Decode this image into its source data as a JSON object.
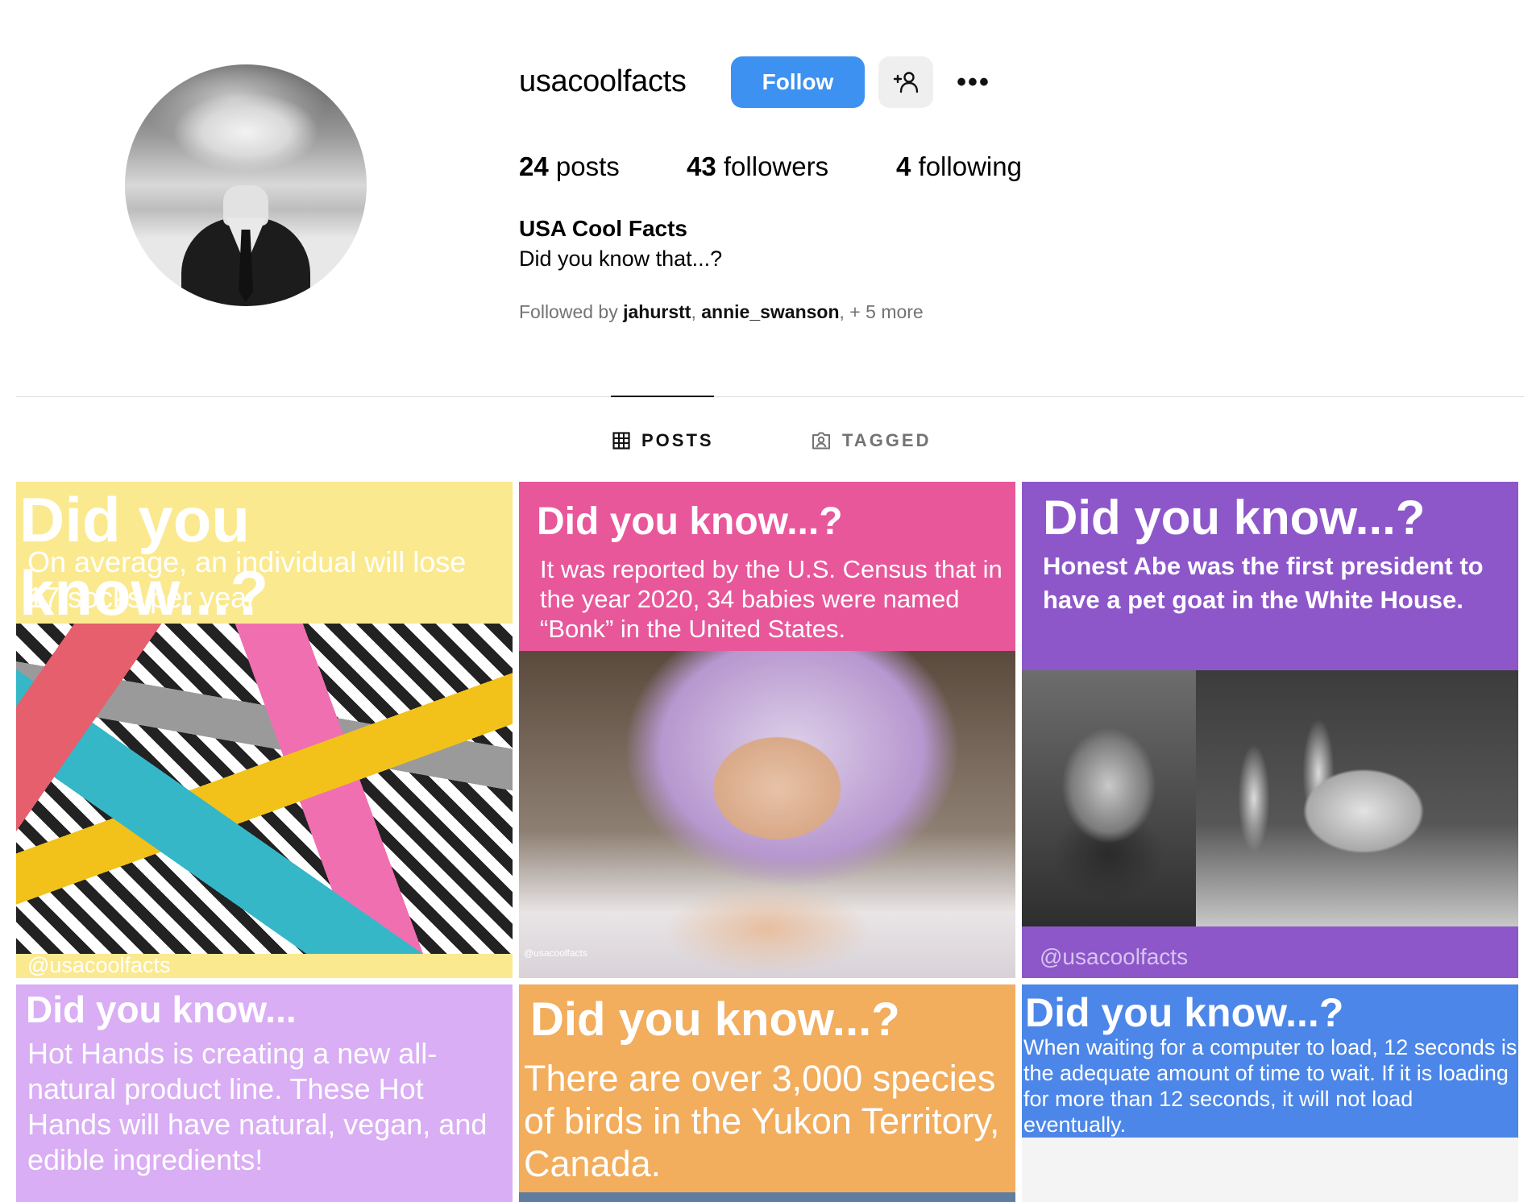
{
  "profile": {
    "username": "usacoolfacts",
    "follow_label": "Follow",
    "more_label": "•••",
    "stats": {
      "posts_count": "24",
      "posts_label": " posts",
      "followers_count": "43",
      "followers_label": " followers",
      "following_count": "4",
      "following_label": " following"
    },
    "full_name": "USA Cool Facts",
    "bio": "Did you know that...?",
    "followed_by": {
      "prefix": "Followed by ",
      "user1": "jahurstt",
      "sep": ", ",
      "user2": "annie_swanson",
      "suffix": ", + 5 more"
    }
  },
  "tabs": [
    {
      "label": "POSTS",
      "icon": "grid-icon",
      "active": true
    },
    {
      "label": "TAGGED",
      "icon": "tagged-icon",
      "active": false
    }
  ],
  "posts": [
    {
      "heading": "Did you know...?",
      "body": "On average, an individual will lose 17 socks per year",
      "credit": "@usacoolfacts",
      "bg_color": "#fbe98f",
      "image": "socks-photo"
    },
    {
      "heading": "Did you know...?",
      "body": "It was reported by the U.S. Census that in the year 2020, 34 babies were named “Bonk” in the United States.",
      "credit": "@usacoolfacts",
      "bg_color": "#e8579a",
      "image": "baby-photo"
    },
    {
      "heading": "Did you know...?",
      "body": "Honest Abe was the first president to have a pet goat in the White House.",
      "credit": "@usacoolfacts",
      "bg_color": "#8d57ca",
      "image": "lincoln-goat-photos"
    },
    {
      "heading": "Did you know...",
      "body": "Hot Hands is creating a new all-natural product line. These Hot Hands will have natural, vegan, and edible ingredients!",
      "bg_color": "#d9aef4"
    },
    {
      "heading": "Did you know...?",
      "body": "There are over 3,000 species of birds in the Yukon Territory, Canada.",
      "bg_color": "#f2ad5d"
    },
    {
      "heading": "Did you know...?",
      "body": "When waiting for a computer to load, 12 seconds is the adequate amount of time to wait. If it is loading for more than 12 seconds, it will not load eventually.",
      "bg_color": "#4c86e8"
    }
  ],
  "colors": {
    "accent": "#3d91f0",
    "muted_text": "#737373",
    "divider": "#dbdbdb"
  }
}
